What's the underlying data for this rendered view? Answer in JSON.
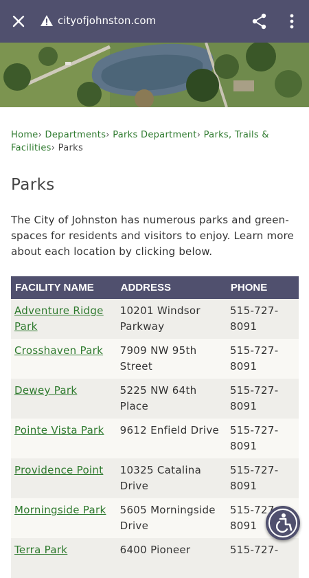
{
  "browser": {
    "url": "cityofjohnston.com",
    "icons": {
      "close": "close-icon",
      "warning": "warning-icon",
      "share": "share-icon",
      "more": "more-vert-icon"
    },
    "bar_color": "#50506e"
  },
  "breadcrumb": {
    "items": [
      "Home",
      "Departments",
      "Parks Department",
      "Parks, Trails & Facilities"
    ],
    "current": "Parks",
    "separator": "›"
  },
  "page": {
    "title": "Parks",
    "intro": "The City of Johnston has numerous parks and green-spaces for residents and visitors to enjoy. Learn more about each location by clicking below."
  },
  "table": {
    "headers": [
      "FACILITY NAME",
      "ADDRESS",
      "PHONE"
    ],
    "rows": [
      {
        "name": "Adventure Ridge Park",
        "address": "10201 Windsor Parkway",
        "phone": "515-727-8091"
      },
      {
        "name": "Crosshaven Park",
        "address": "7909 NW 95th Street",
        "phone": "515-727-8091"
      },
      {
        "name": "Dewey Park",
        "address": "5225 NW 64th Place",
        "phone": "515-727-8091"
      },
      {
        "name": "Pointe Vista Park",
        "address": "9612 Enfield Drive",
        "phone": "515-727-8091"
      },
      {
        "name": "Providence Point",
        "address": "10325 Catalina Drive",
        "phone": "515-727-8091"
      },
      {
        "name": "Morningside Park",
        "address": "5605 Morningside Drive",
        "phone": "515-727-8091"
      },
      {
        "name": "Terra Park",
        "address": "6400 Pioneer",
        "phone": "515-727-"
      }
    ]
  },
  "accessibility": {
    "icon": "accessibility-icon"
  },
  "colors": {
    "accent": "#50506e",
    "link": "#2e7a2e",
    "row_alt_1": "#efeeea",
    "row_alt_2": "#f9f8f4"
  }
}
